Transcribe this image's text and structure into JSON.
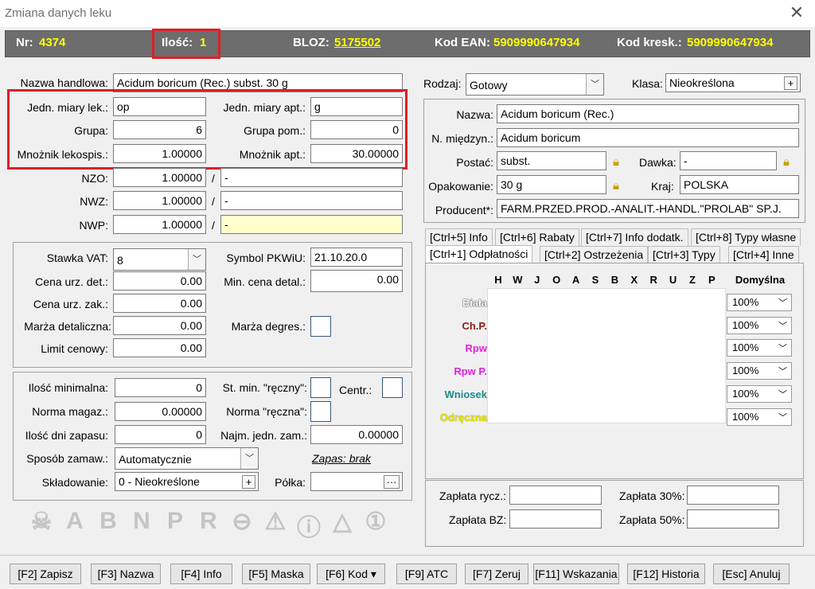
{
  "window": {
    "title": "Zmiana danych leku",
    "close": "✕"
  },
  "header": {
    "nr_label": "Nr:",
    "nr": "4374",
    "ilosc_label": "Ilość:",
    "ilosc": "1",
    "bloz_label": "BLOZ:",
    "bloz": "5175502",
    "ean_label": "Kod EAN:",
    "ean": "5909990647934",
    "kresk_label": "Kod kresk.:",
    "kresk": "5909990647934"
  },
  "left": {
    "nazwa_label": "Nazwa handlowa:",
    "nazwa": "Acidum boricum (Rec.) subst. 30 g",
    "jml_label": "Jedn. miary lek.:",
    "jml": "op",
    "jma_label": "Jedn. miary apt.:",
    "jma": "g",
    "grupa_label": "Grupa:",
    "grupa": "6",
    "grupa_pom_label": "Grupa pom.:",
    "grupa_pom": "0",
    "mnoz_lek_label": "Mnożnik lekospis.:",
    "mnoz_lek": "1.00000",
    "mnoz_apt_label": "Mnożnik apt.:",
    "mnoz_apt": "30.00000",
    "nzo_label": "NZO:",
    "nzo": "1.00000",
    "nwz_label": "NWZ:",
    "nwz": "1.00000",
    "nwp_label": "NWP:",
    "nwp": "1.00000",
    "slash": "/",
    "dash": "-"
  },
  "price": {
    "vat_label": "Stawka VAT:",
    "vat": "8",
    "pkwiu_label": "Symbol PKWiU:",
    "pkwiu": "21.10.20.0",
    "cena_det_label": "Cena urz. det.:",
    "cena_det": "0.00",
    "min_cena_label": "Min. cena detal.:",
    "min_cena": "0.00",
    "cena_zak_label": "Cena urz. zak.:",
    "cena_zak": "0.00",
    "marza_det_label": "Marża detaliczna:",
    "marza_det": "0.00",
    "marza_degres_label": "Marża degres.:",
    "limit_label": "Limit cenowy:",
    "limit": "0.00"
  },
  "stock": {
    "ilosc_min_label": "Ilość minimalna:",
    "ilosc_min": "0",
    "st_min_label": "St. min. \"ręczny\":",
    "centr_label": "Centr.:",
    "norma_label": "Norma magaz.:",
    "norma": "0.00000",
    "norma_reczna_label": "Norma \"ręczna\":",
    "dni_label": "Ilość dni zapasu:",
    "dni": "0",
    "najm_label": "Najm. jedn. zam.:",
    "najm": "0.00000",
    "sposob_label": "Sposób zamaw.:",
    "sposob": "Automatycznie",
    "zapasy": "Zapas: brak",
    "skladowanie_label": "Składowanie:",
    "skladowanie": "0 - Nieokreślone",
    "polka_label": "Półka:",
    "polka_btn": "···"
  },
  "status_icons": [
    "skull-icon",
    "A",
    "B",
    "N",
    "P",
    "R",
    "minus-circle-icon",
    "warning-icon",
    "info-bubble-icon",
    "alert-triangle-icon",
    "number-one-icon"
  ],
  "status_letters": {
    "a": "A",
    "b": "B",
    "n": "N",
    "p": "P",
    "r": "R"
  },
  "right": {
    "rodzaj_label": "Rodzaj:",
    "rodzaj": "Gotowy",
    "klasa_label": "Klasa:",
    "klasa": "Nieokreślona",
    "nazwa_label": "Nazwa:",
    "nazwa": "Acidum boricum (Rec.)",
    "miedzyn_label": "N. międzyn.:",
    "miedzyn": "Acidum boricum",
    "postac_label": "Postać:",
    "postac": "subst.",
    "dawka_label": "Dawka:",
    "dawka": "-",
    "opak_label": "Opakowanie:",
    "opak": "30 g",
    "kraj_label": "Kraj:",
    "kraj": "POLSKA",
    "producent_label": "Producent*:",
    "producent": "FARM.PRZED.PROD.-ANALIT.-HANDL.\"PROLAB\" SP.J."
  },
  "tabs": {
    "row1": [
      "[Ctrl+5] Info",
      "[Ctrl+6] Rabaty",
      "[Ctrl+7] Info dodatk.",
      "[Ctrl+8] Typy własne"
    ],
    "row2": [
      "[Ctrl+1] Odpłatności",
      "[Ctrl+2] Ostrzeżenia",
      "[Ctrl+3] Typy",
      "[Ctrl+4] Inne"
    ]
  },
  "grid": {
    "columns": [
      "H",
      "W",
      "J",
      "O",
      "A",
      "S",
      "B",
      "X",
      "R",
      "U",
      "Z",
      "P"
    ],
    "default_col": "Domyślna",
    "rows": [
      {
        "name": "Biała",
        "color": "#ffffff",
        "value": "100%"
      },
      {
        "name": "Ch.P.",
        "color": "#8b1a1a",
        "value": "100%"
      },
      {
        "name": "Rpw",
        "color": "#e020e0",
        "value": "100%"
      },
      {
        "name": "Rpw P.",
        "color": "#e020e0",
        "value": "100%"
      },
      {
        "name": "Wniosek",
        "color": "#1a8a8a",
        "value": "100%"
      },
      {
        "name": "Odręczna",
        "color": "#e8e800",
        "value": "100%"
      }
    ]
  },
  "payments": {
    "rycz_label": "Zapłata rycz.:",
    "p30_label": "Zapłata 30%:",
    "bz_label": "Zapłata BZ:",
    "p50_label": "Zapłata 50%:"
  },
  "buttons": [
    "[F2] Zapisz",
    "[F3] Nazwa",
    "[F4] Info",
    "[F5] Maska",
    "[F6] Kod ▾",
    "[F9] ATC",
    "[F7] Zeruj",
    "[F11] Wskazania",
    "[F12] Historia",
    "[Esc] Anuluj"
  ]
}
